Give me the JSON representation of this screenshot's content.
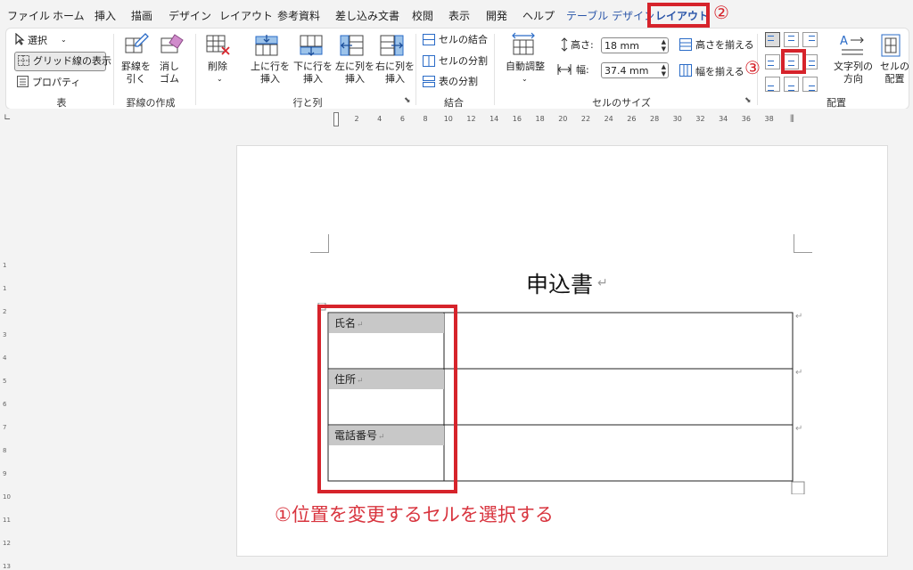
{
  "tabs": [
    {
      "label": "ファイル"
    },
    {
      "label": "ホーム"
    },
    {
      "label": "挿入"
    },
    {
      "label": "描画"
    },
    {
      "label": "デザイン"
    },
    {
      "label": "レイアウト"
    },
    {
      "label": "参考資料"
    },
    {
      "label": "差し込み文書"
    },
    {
      "label": "校閲"
    },
    {
      "label": "表示"
    },
    {
      "label": "開発"
    },
    {
      "label": "ヘルプ"
    },
    {
      "label": "テーブル デザイン"
    },
    {
      "label": "レイアウト"
    }
  ],
  "ribbon": {
    "table": {
      "select": "選択",
      "gridlines": "グリッド線の表示",
      "properties": "プロパティ",
      "group": "表"
    },
    "draw": {
      "draw_table": "罫線を\n引く",
      "eraser": "消し\nゴム",
      "group": "罫線の作成"
    },
    "rows_cols": {
      "delete": "削除",
      "insert_above": "上に行を\n挿入",
      "insert_below": "下に行を\n挿入",
      "insert_left": "左に列を\n挿入",
      "insert_right": "右に列を\n挿入",
      "group": "行と列"
    },
    "merge": {
      "merge_cells": "セルの結合",
      "split_cells": "セルの分割",
      "split_table": "表の分割",
      "group": "結合"
    },
    "cell_size": {
      "autofit": "自動調整",
      "height_label": "高さ:",
      "height_value": "18 mm",
      "width_label": "幅:",
      "width_value": "37.4 mm",
      "distribute_rows": "高さを揃える",
      "distribute_cols": "幅を揃える",
      "group": "セルのサイズ"
    },
    "alignment": {
      "text_direction": "文字列の\n方向",
      "cell_margins": "セルの\n配置",
      "group": "配置"
    }
  },
  "ruler": {
    "numbers": [
      "2",
      "4",
      "6",
      "8",
      "10",
      "12",
      "14",
      "16",
      "18",
      "20",
      "22",
      "24",
      "26",
      "28",
      "30",
      "32",
      "34",
      "36",
      "38"
    ]
  },
  "vruler": {
    "numbers": [
      "1",
      "1",
      "2",
      "3",
      "4",
      "5",
      "6",
      "7",
      "8",
      "9",
      "10",
      "11",
      "12",
      "13"
    ]
  },
  "document": {
    "title": "申込書",
    "rows": [
      {
        "label": "氏名"
      },
      {
        "label": "住所"
      },
      {
        "label": "電話番号"
      }
    ]
  },
  "annotations": {
    "step1": "①位置を変更するセルを選択する",
    "step2": "②",
    "step3": "③"
  },
  "colors": {
    "accent_red": "#d6232b",
    "tab_blue": "#2a55a8"
  }
}
